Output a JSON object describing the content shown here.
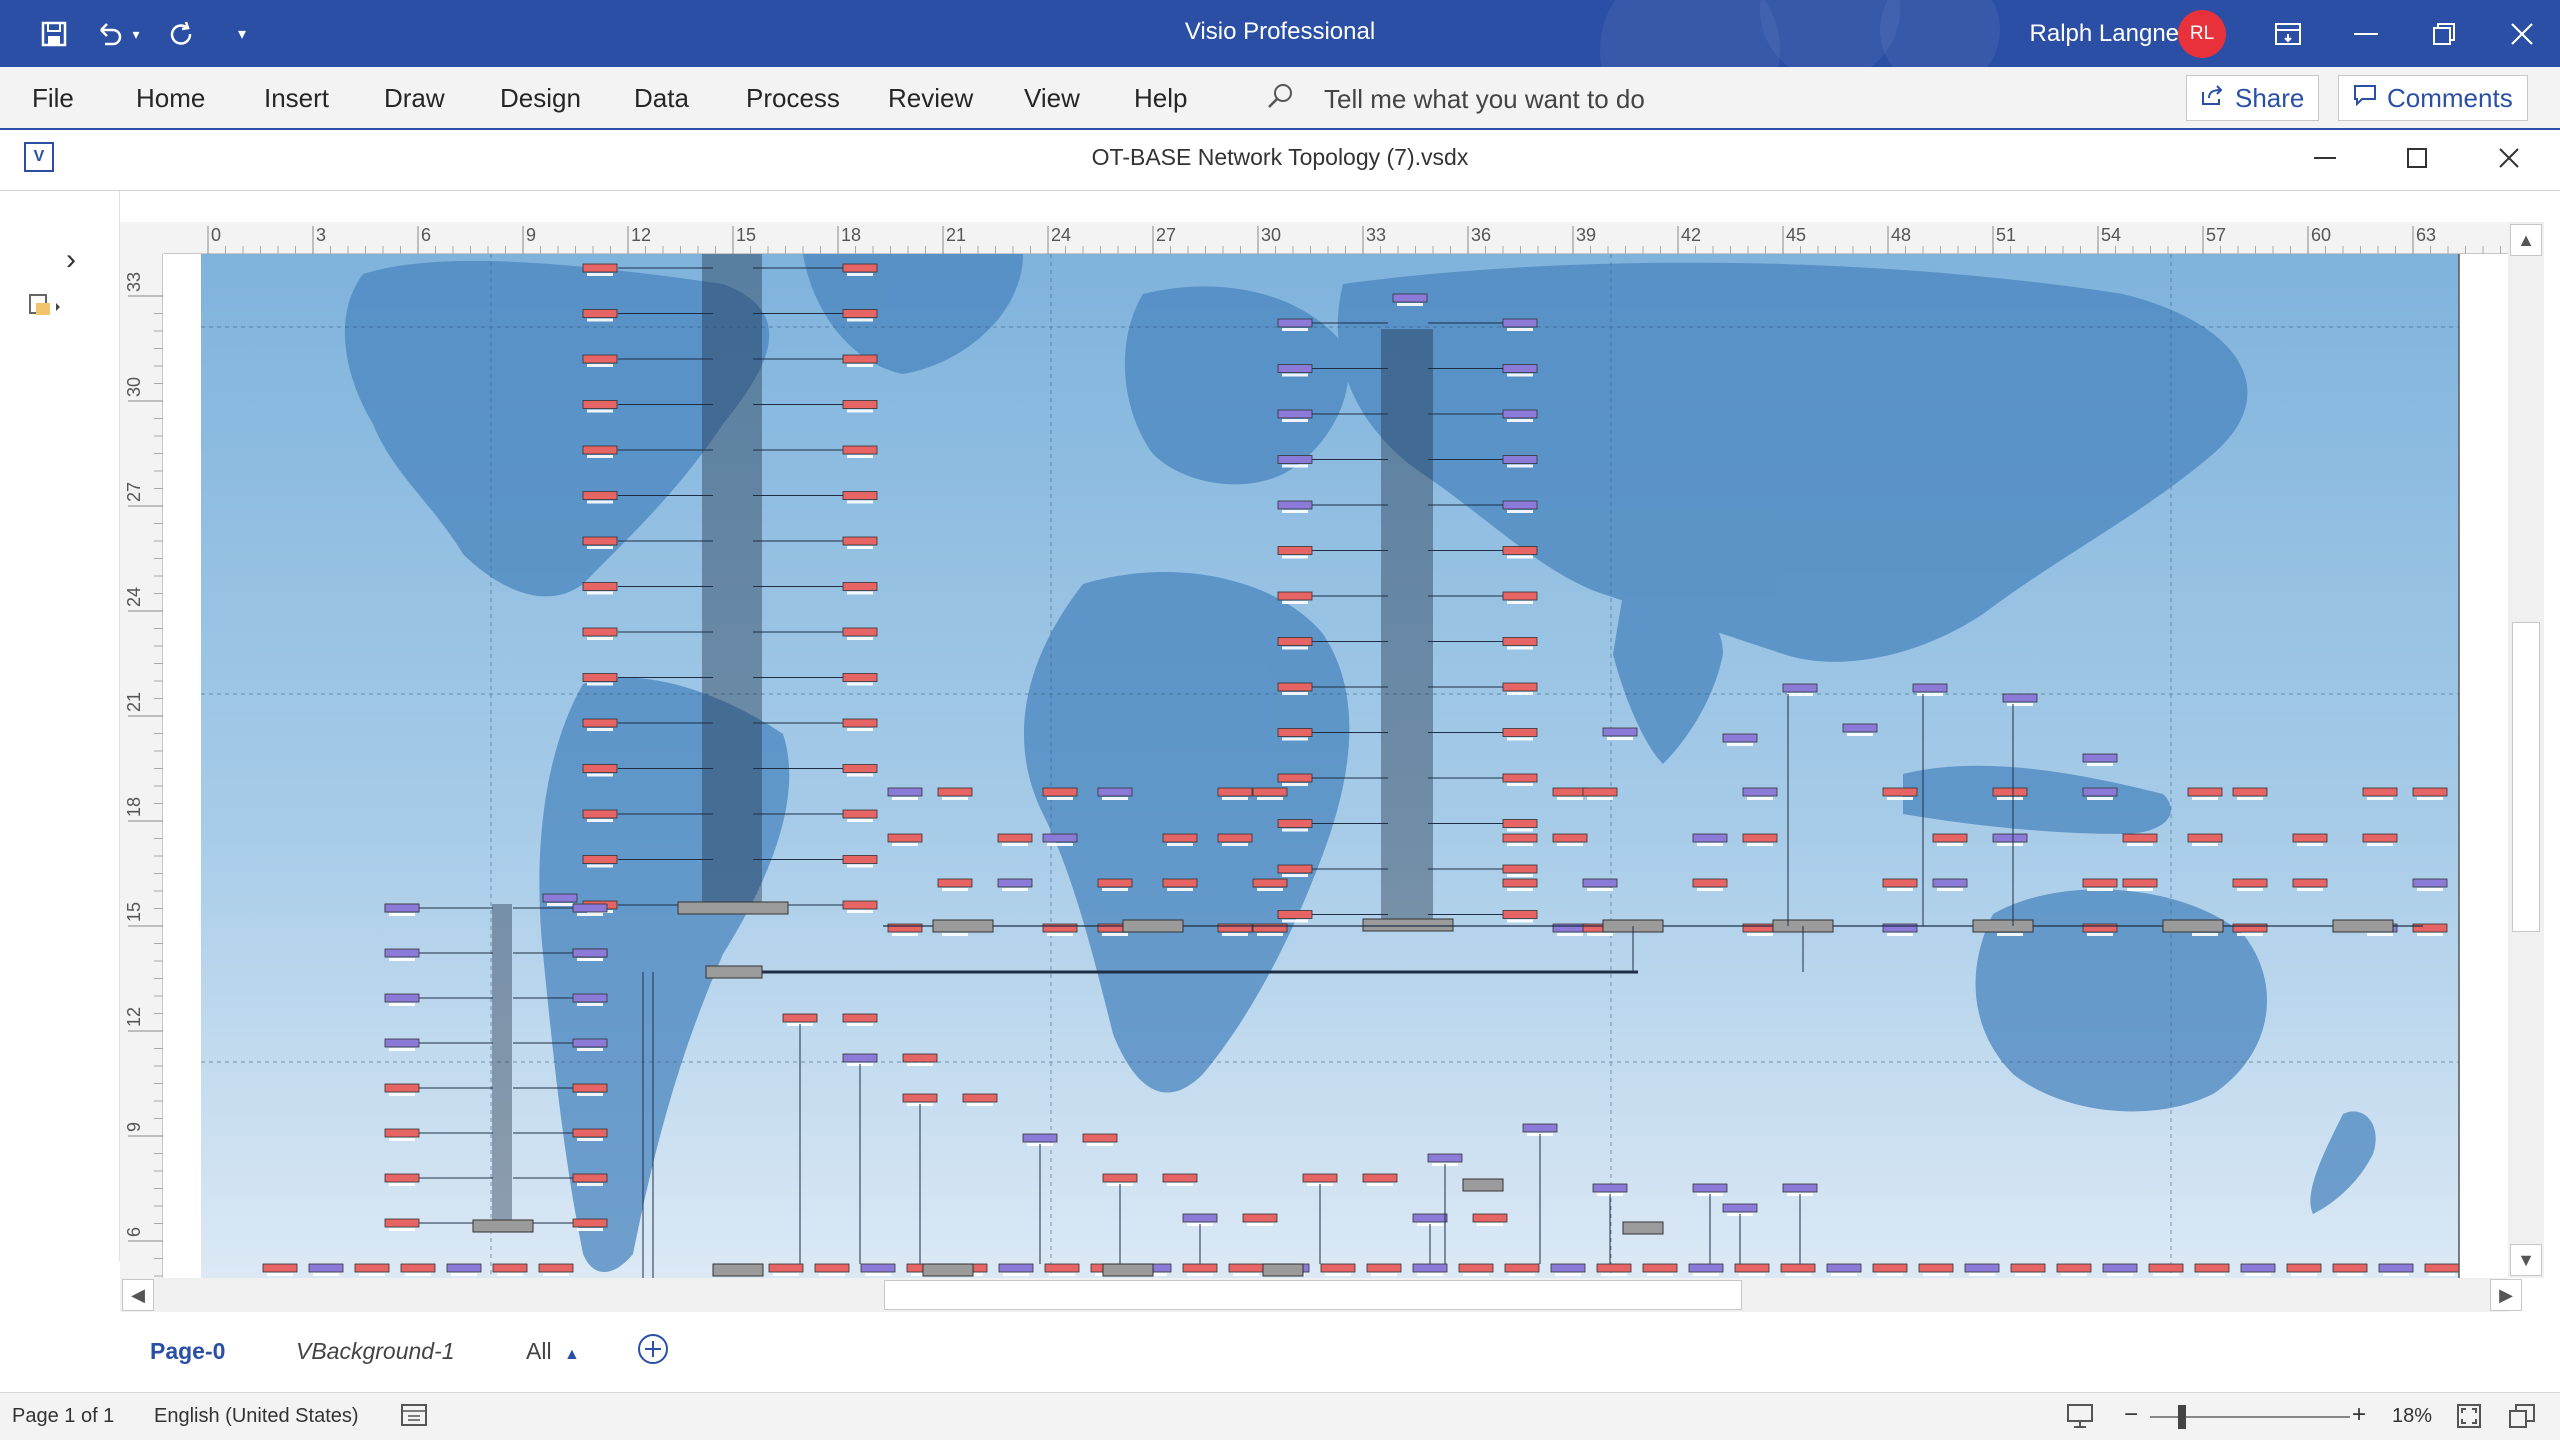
{
  "app": {
    "title": "Visio Professional",
    "user_name": "Ralph Langner",
    "avatar_initials": "RL",
    "accent": "#2a4fa5"
  },
  "quick_access": {
    "save_icon": "save-icon",
    "undo_icon": "undo-icon",
    "redo_icon": "redo-icon",
    "customize_icon": "customize-icon"
  },
  "window_controls": [
    "ribbon-display-icon",
    "minimize-icon",
    "restore-icon",
    "close-icon"
  ],
  "ribbon": {
    "tabs": [
      "File",
      "Home",
      "Insert",
      "Draw",
      "Design",
      "Data",
      "Process",
      "Review",
      "View",
      "Help"
    ],
    "tell_me": "Tell me what you want to do",
    "share_label": "Share",
    "comments_label": "Comments"
  },
  "document": {
    "title": "OT-BASE Network Topology (7).vsdx"
  },
  "ruler": {
    "h_labels": [
      "0",
      "3",
      "6",
      "9",
      "12",
      "15",
      "18",
      "21",
      "24",
      "27",
      "30",
      "33",
      "36",
      "39",
      "42",
      "45",
      "48",
      "51",
      "54",
      "57",
      "60",
      "63"
    ],
    "v_labels": [
      "33",
      "30",
      "27",
      "24",
      "21",
      "18",
      "15",
      "12",
      "9",
      "6"
    ]
  },
  "page_tabs": {
    "active": "Page-0",
    "background": "VBackground-1",
    "all_label": "All"
  },
  "status": {
    "page": "Page 1 of 1",
    "language": "English (United States)",
    "zoom": "18%",
    "zoom_level": 0.18
  },
  "colors": {
    "map_sky": "#7fb3dc",
    "land": "#4a86bf",
    "device_red": "#e66464",
    "device_purple": "#8c7ad9",
    "switch_gray": "#9b9b9b"
  }
}
